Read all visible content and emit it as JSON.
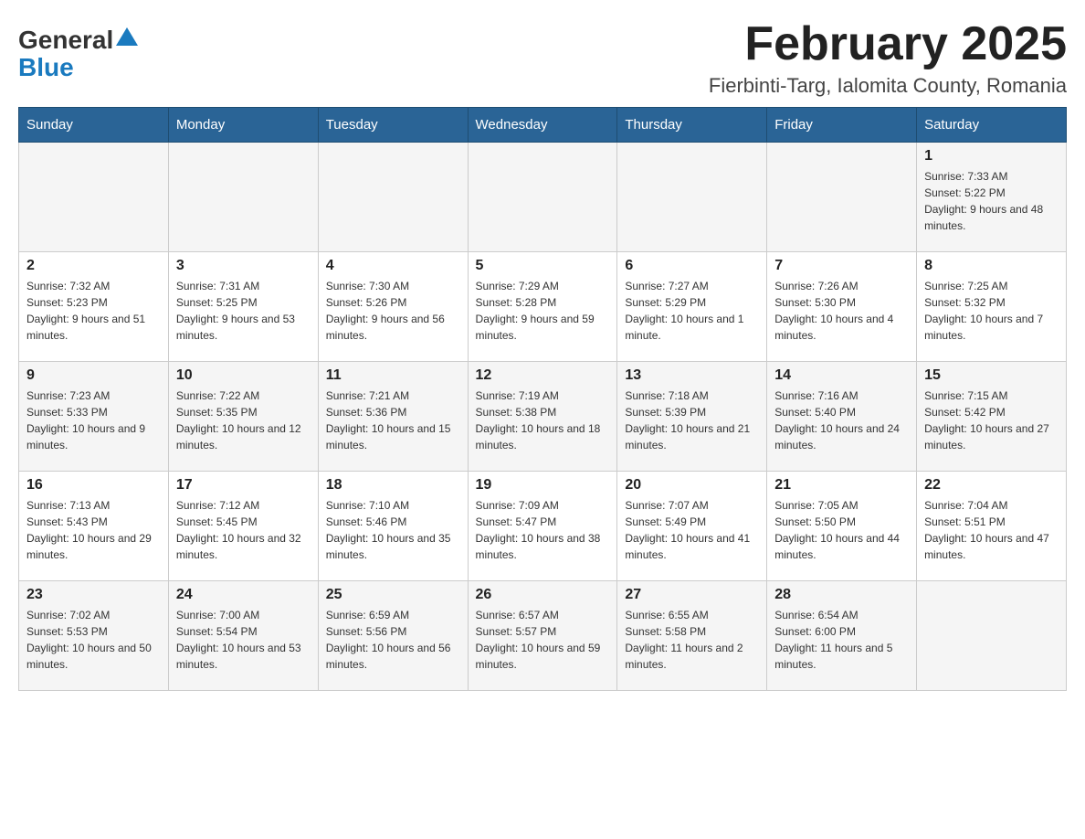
{
  "header": {
    "title": "February 2025",
    "location": "Fierbinti-Targ, Ialomita County, Romania",
    "logo_line1": "General",
    "logo_line2": "Blue"
  },
  "weekdays": [
    "Sunday",
    "Monday",
    "Tuesday",
    "Wednesday",
    "Thursday",
    "Friday",
    "Saturday"
  ],
  "weeks": [
    [
      {
        "day": "",
        "info": ""
      },
      {
        "day": "",
        "info": ""
      },
      {
        "day": "",
        "info": ""
      },
      {
        "day": "",
        "info": ""
      },
      {
        "day": "",
        "info": ""
      },
      {
        "day": "",
        "info": ""
      },
      {
        "day": "1",
        "info": "Sunrise: 7:33 AM\nSunset: 5:22 PM\nDaylight: 9 hours and 48 minutes."
      }
    ],
    [
      {
        "day": "2",
        "info": "Sunrise: 7:32 AM\nSunset: 5:23 PM\nDaylight: 9 hours and 51 minutes."
      },
      {
        "day": "3",
        "info": "Sunrise: 7:31 AM\nSunset: 5:25 PM\nDaylight: 9 hours and 53 minutes."
      },
      {
        "day": "4",
        "info": "Sunrise: 7:30 AM\nSunset: 5:26 PM\nDaylight: 9 hours and 56 minutes."
      },
      {
        "day": "5",
        "info": "Sunrise: 7:29 AM\nSunset: 5:28 PM\nDaylight: 9 hours and 59 minutes."
      },
      {
        "day": "6",
        "info": "Sunrise: 7:27 AM\nSunset: 5:29 PM\nDaylight: 10 hours and 1 minute."
      },
      {
        "day": "7",
        "info": "Sunrise: 7:26 AM\nSunset: 5:30 PM\nDaylight: 10 hours and 4 minutes."
      },
      {
        "day": "8",
        "info": "Sunrise: 7:25 AM\nSunset: 5:32 PM\nDaylight: 10 hours and 7 minutes."
      }
    ],
    [
      {
        "day": "9",
        "info": "Sunrise: 7:23 AM\nSunset: 5:33 PM\nDaylight: 10 hours and 9 minutes."
      },
      {
        "day": "10",
        "info": "Sunrise: 7:22 AM\nSunset: 5:35 PM\nDaylight: 10 hours and 12 minutes."
      },
      {
        "day": "11",
        "info": "Sunrise: 7:21 AM\nSunset: 5:36 PM\nDaylight: 10 hours and 15 minutes."
      },
      {
        "day": "12",
        "info": "Sunrise: 7:19 AM\nSunset: 5:38 PM\nDaylight: 10 hours and 18 minutes."
      },
      {
        "day": "13",
        "info": "Sunrise: 7:18 AM\nSunset: 5:39 PM\nDaylight: 10 hours and 21 minutes."
      },
      {
        "day": "14",
        "info": "Sunrise: 7:16 AM\nSunset: 5:40 PM\nDaylight: 10 hours and 24 minutes."
      },
      {
        "day": "15",
        "info": "Sunrise: 7:15 AM\nSunset: 5:42 PM\nDaylight: 10 hours and 27 minutes."
      }
    ],
    [
      {
        "day": "16",
        "info": "Sunrise: 7:13 AM\nSunset: 5:43 PM\nDaylight: 10 hours and 29 minutes."
      },
      {
        "day": "17",
        "info": "Sunrise: 7:12 AM\nSunset: 5:45 PM\nDaylight: 10 hours and 32 minutes."
      },
      {
        "day": "18",
        "info": "Sunrise: 7:10 AM\nSunset: 5:46 PM\nDaylight: 10 hours and 35 minutes."
      },
      {
        "day": "19",
        "info": "Sunrise: 7:09 AM\nSunset: 5:47 PM\nDaylight: 10 hours and 38 minutes."
      },
      {
        "day": "20",
        "info": "Sunrise: 7:07 AM\nSunset: 5:49 PM\nDaylight: 10 hours and 41 minutes."
      },
      {
        "day": "21",
        "info": "Sunrise: 7:05 AM\nSunset: 5:50 PM\nDaylight: 10 hours and 44 minutes."
      },
      {
        "day": "22",
        "info": "Sunrise: 7:04 AM\nSunset: 5:51 PM\nDaylight: 10 hours and 47 minutes."
      }
    ],
    [
      {
        "day": "23",
        "info": "Sunrise: 7:02 AM\nSunset: 5:53 PM\nDaylight: 10 hours and 50 minutes."
      },
      {
        "day": "24",
        "info": "Sunrise: 7:00 AM\nSunset: 5:54 PM\nDaylight: 10 hours and 53 minutes."
      },
      {
        "day": "25",
        "info": "Sunrise: 6:59 AM\nSunset: 5:56 PM\nDaylight: 10 hours and 56 minutes."
      },
      {
        "day": "26",
        "info": "Sunrise: 6:57 AM\nSunset: 5:57 PM\nDaylight: 10 hours and 59 minutes."
      },
      {
        "day": "27",
        "info": "Sunrise: 6:55 AM\nSunset: 5:58 PM\nDaylight: 11 hours and 2 minutes."
      },
      {
        "day": "28",
        "info": "Sunrise: 6:54 AM\nSunset: 6:00 PM\nDaylight: 11 hours and 5 minutes."
      },
      {
        "day": "",
        "info": ""
      }
    ]
  ],
  "colors": {
    "header_bg": "#2a6496",
    "header_text": "#ffffff",
    "alt_row_bg": "#f5f5f5",
    "border": "#cccccc"
  }
}
